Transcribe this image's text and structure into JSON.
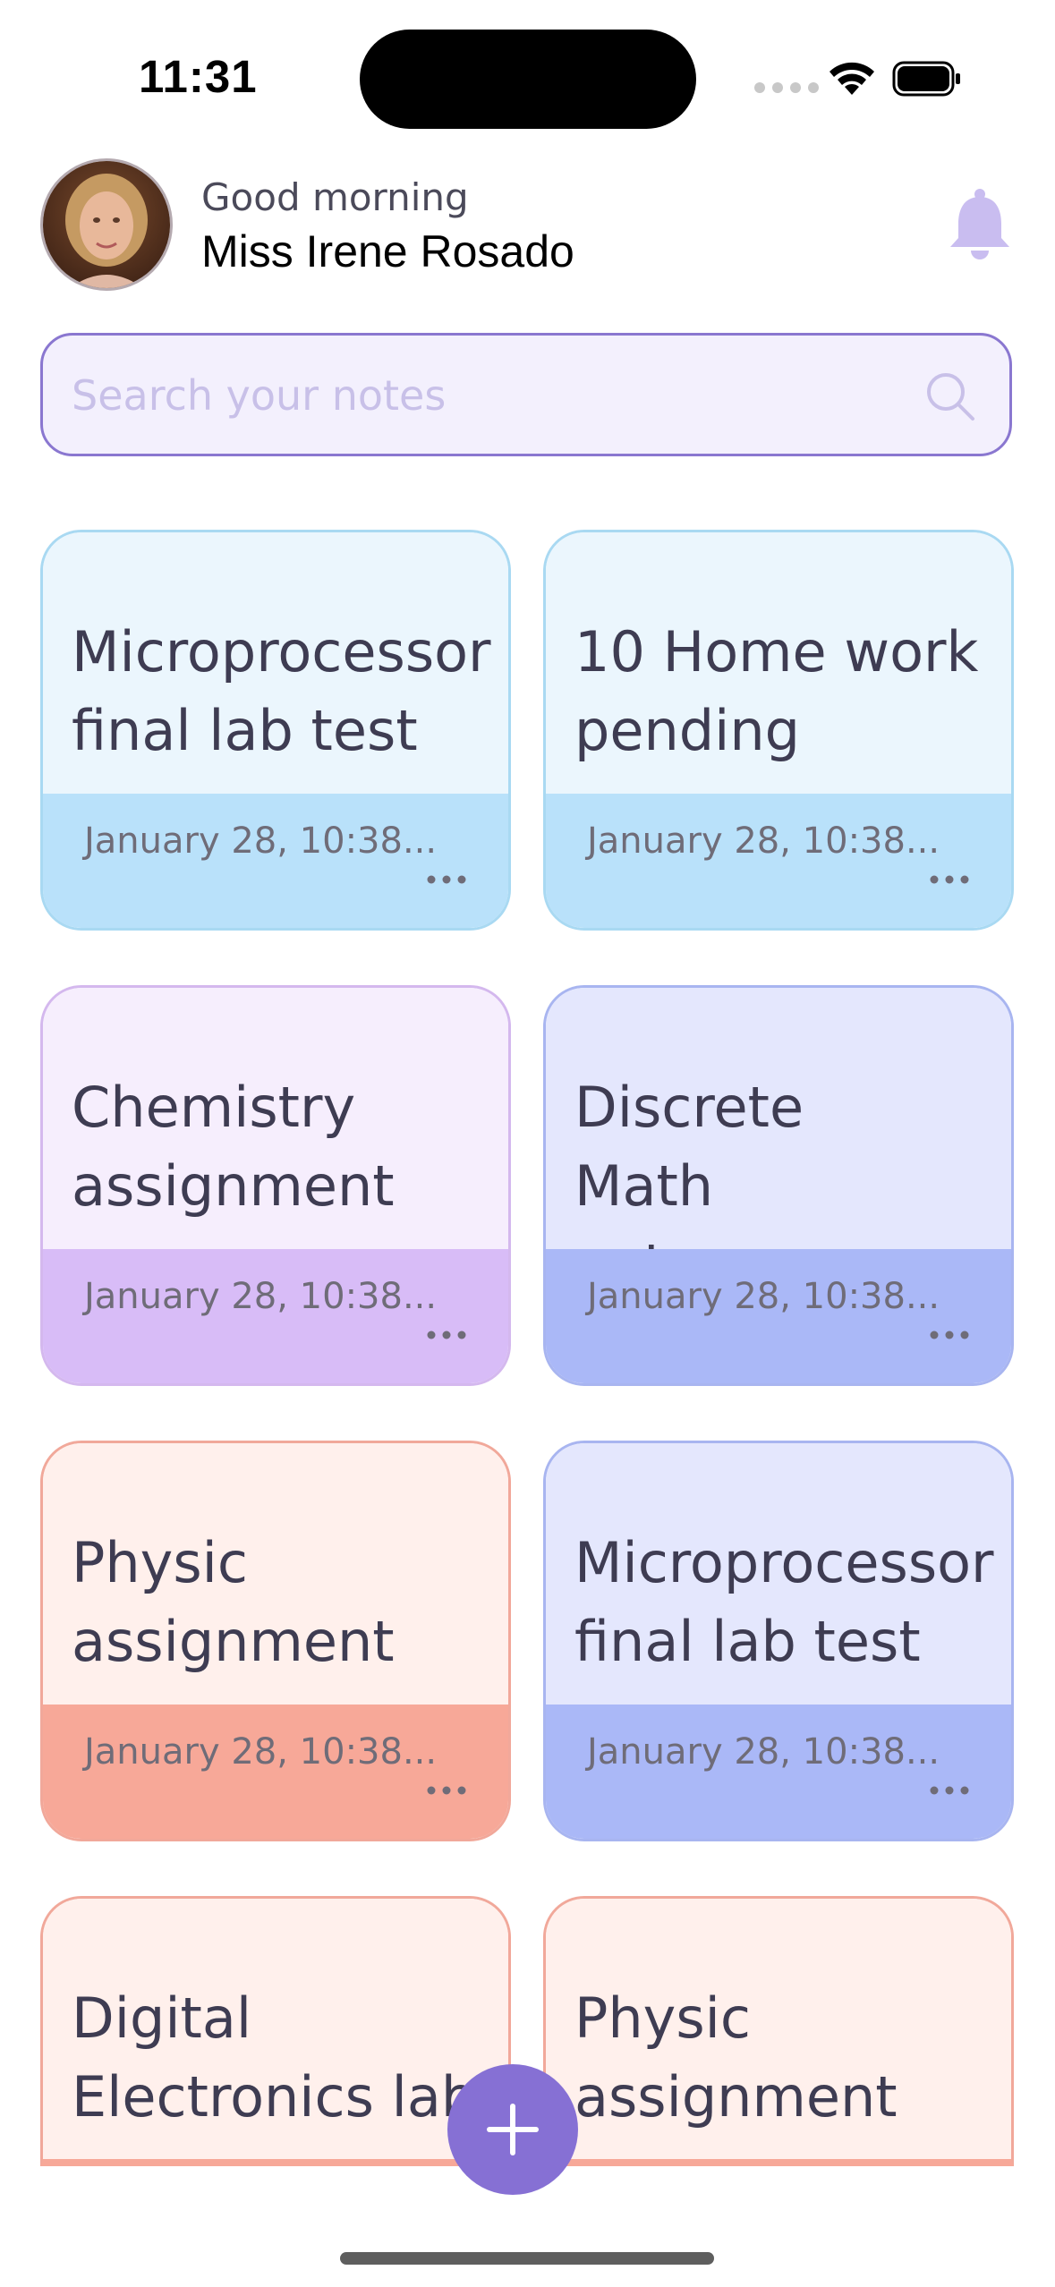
{
  "status_bar": {
    "time": "11:31"
  },
  "header": {
    "greeting": "Good morning",
    "user_name": "Miss Irene Rosado",
    "avatar_icon": "user-avatar",
    "bell_icon": "bell-icon"
  },
  "search": {
    "placeholder": "Search your notes",
    "value": ""
  },
  "notes": [
    {
      "title": "Microprocessor final lab test",
      "date": "January 28, 10:38...",
      "theme": "blue"
    },
    {
      "title": "10 Home work pending",
      "date": "January 28, 10:38...",
      "theme": "blue"
    },
    {
      "title": "Chemistry assignment",
      "date": "January 28, 10:38...",
      "theme": "purple"
    },
    {
      "title": "Discrete Math notes",
      "date": "January 28, 10:38...",
      "theme": "indigo"
    },
    {
      "title": "Physic assignment",
      "date": "January 28, 10:38...",
      "theme": "salmon"
    },
    {
      "title": "Microprocessor final lab test",
      "date": "January 28, 10:38...",
      "theme": "indigo"
    },
    {
      "title": "Digital Electronics lab",
      "theme": "salmon"
    },
    {
      "title": "Physic assignment",
      "theme": "salmon"
    }
  ],
  "colors": {
    "accent": "#8670d4",
    "search_border": "#8a77d0",
    "search_bg": "#f3f0fd",
    "bell": "#c9bdf0",
    "blue_top": "#ebf6fd",
    "blue_bottom": "#b9e1fa",
    "purple_top": "#f6eefd",
    "purple_bottom": "#d8bcf7",
    "indigo_top": "#e4e7fd",
    "indigo_bottom": "#aab8f7",
    "salmon_top": "#fff0ec",
    "salmon_bottom": "#f7a898"
  },
  "fab": {
    "icon": "plus-icon"
  }
}
